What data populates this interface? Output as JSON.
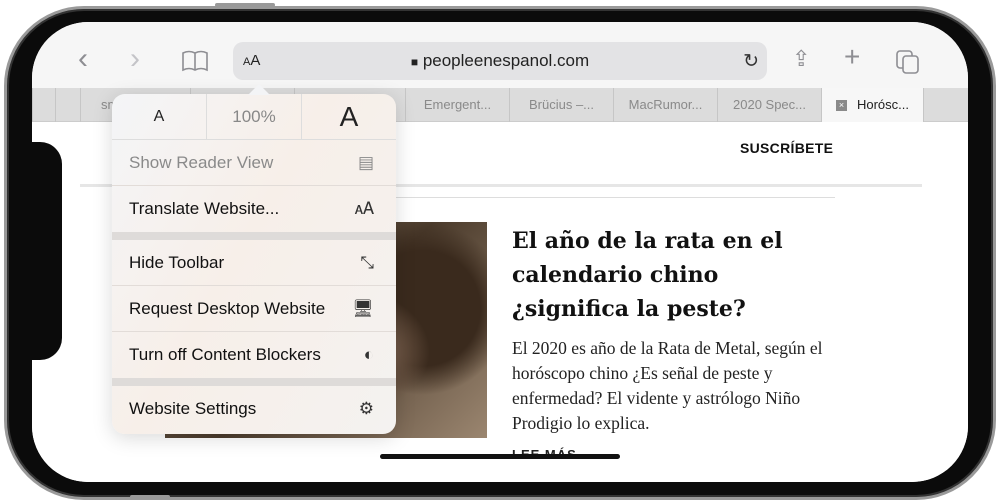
{
  "toolbar": {
    "back": "‹",
    "forward": "›",
    "bookmarks_icon": "book-icon",
    "aa_small": "A",
    "aa_big": "A",
    "lock": "🔒",
    "url": "peopleenespanol.com",
    "reload": "↻",
    "share": "⇪",
    "new_tab": "+",
    "tabs_icon": "tabs-overview-icon"
  },
  "tabs": [
    "sm",
    "Emergent...",
    "Brücius –...",
    "MacRumor...",
    "2020 Spec...",
    "Horósc..."
  ],
  "active_tab_close": "×",
  "menu": {
    "font_small": "A",
    "zoom": "100%",
    "font_large": "A",
    "items": [
      {
        "label": "Show Reader View",
        "icon": "▤",
        "disabled": true
      },
      {
        "label": "Translate Website...",
        "icon": "🗚"
      },
      {
        "label": "Hide Toolbar",
        "icon": "⤡"
      },
      {
        "label": "Request Desktop Website",
        "icon": "🖥"
      },
      {
        "label": "Turn off Content Blockers",
        "icon": "◐"
      },
      {
        "label": "Website Settings",
        "icon": "⚙"
      }
    ]
  },
  "page": {
    "subscribe": "SUSCRÍBETE",
    "headline": "El año de la rata en el calendario chino ¿significa la peste?",
    "body": "El 2020 es año de la Rata de Metal, según el horóscopo chino ¿Es señal de peste y enfermedad? El vidente y astrólogo Niño Prodigio lo explica.",
    "read_more": "LEE MÁS →"
  }
}
